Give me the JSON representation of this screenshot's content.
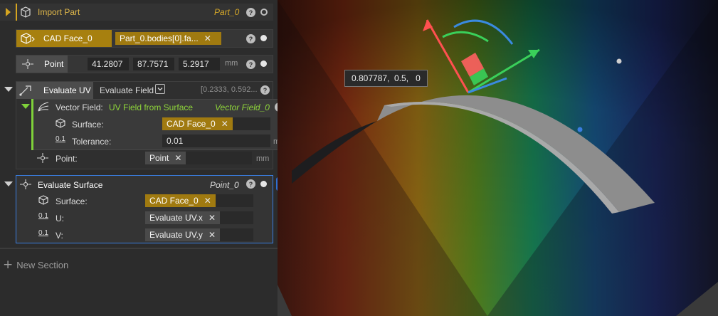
{
  "import_part": {
    "label": "Import Part",
    "output": "Part_0"
  },
  "cad_face": {
    "label": "CAD Face_0",
    "selection": "Part_0.bodies[0].fa..."
  },
  "point": {
    "label": "Point",
    "x": "41.2807",
    "y": "87.7571",
    "z": "5.2917",
    "unit": "mm"
  },
  "evaluate_uv": {
    "label": "Evaluate UV",
    "field_label": "Evaluate Field",
    "result": "[0.2333, 0.592...",
    "vector_field": {
      "label": "Vector Field:",
      "value": "UV Field from Surface",
      "output": "Vector Field_0"
    },
    "surface_label": "Surface:",
    "surface_value": "CAD Face_0",
    "tolerance_label": "Tolerance:",
    "tolerance_value": "0.01",
    "tolerance_unit": "mm",
    "point_label": "Point:",
    "point_value": "Point",
    "point_unit": "mm"
  },
  "evaluate_surface": {
    "label": "Evaluate Surface",
    "output": "Point_0",
    "surface_label": "Surface:",
    "surface_value": "CAD Face_0",
    "u_label": "U:",
    "u_value": "Evaluate UV.x",
    "v_label": "V:",
    "v_value": "Evaluate UV.y"
  },
  "new_section": "New Section",
  "icon_glyphs": {
    "help": "?",
    "close": "✕",
    "plus": "+",
    "chevron": "⌄",
    "num": "0.1"
  },
  "viewport": {
    "tooltip": "0.807787,  0.5,   0"
  },
  "colors": {
    "accent_gold": "#a7800f",
    "accent_blue": "#3a7de0",
    "accent_green": "#7fd13a"
  }
}
